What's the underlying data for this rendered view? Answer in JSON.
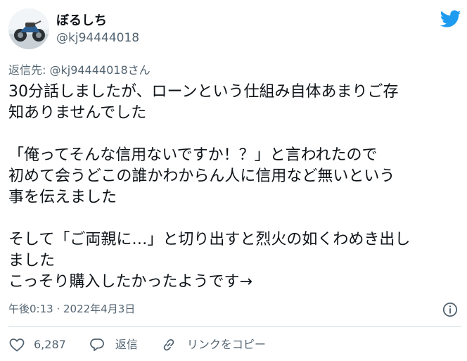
{
  "author": {
    "display_name": "ぼるしち",
    "handle": "@kj94444018"
  },
  "reply": {
    "prefix": "返信先: ",
    "to": "@kj94444018さん"
  },
  "tweet": {
    "text": "30分話しましたが、ローンという仕組み自体あまりご存\n知ありませんでした\n\n「俺ってそんな信用ないですか！？」と言われたので\n初めて会うどこの誰かわからん人に信用など無いという\n事を伝えました\n\nそして「ご両親に…」と切り出すと烈火の如くわめき出し\nました\nこっそり購入したかったようです→"
  },
  "meta": {
    "timestamp": "午後0:13 · 2022年4月3日"
  },
  "actions": {
    "like_count": "6,287",
    "reply_label": "返信",
    "copy_link_label": "リンクをコピー"
  },
  "colors": {
    "twitter_blue": "#1d9bf0",
    "secondary_text": "#536471",
    "divider": "#cfd9de"
  },
  "icons": {
    "logo": "twitter-bird-icon",
    "info": "info-icon",
    "like": "heart-icon",
    "reply": "speech-bubble-icon",
    "copy": "link-icon"
  }
}
